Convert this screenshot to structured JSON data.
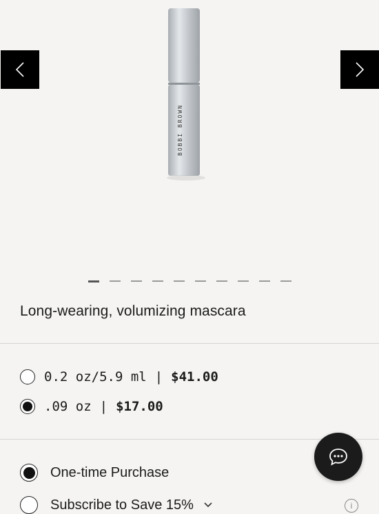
{
  "product": {
    "image_brand": "BOBBI BROWN",
    "tagline": "Long-wearing, volumizing mascara"
  },
  "gallery": {
    "slide_count": 10,
    "active_slide": 1,
    "prev_icon": "chevron-left-icon",
    "next_icon": "chevron-right-icon"
  },
  "sizes": [
    {
      "size": "0.2 oz/5.9 ml",
      "separator": "|",
      "price": "$41.00",
      "selected": false
    },
    {
      "size": ".09 oz",
      "separator": "|",
      "price": "$17.00",
      "selected": true
    }
  ],
  "purchase": {
    "one_time_label": "One-time Purchase",
    "one_time_selected": true,
    "subscribe_label": "Subscribe to Save 15%",
    "subscribe_selected": false
  },
  "chat": {
    "icon": "chat-bubble-icon"
  },
  "colors": {
    "background": "#f5f4f2",
    "button": "#000000",
    "accent": "#1b1b1b"
  }
}
